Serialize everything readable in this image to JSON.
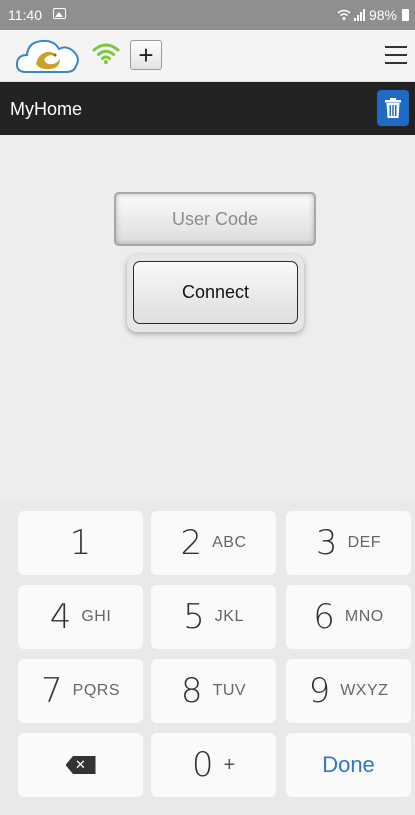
{
  "status_bar": {
    "time": "11:40",
    "battery": "98%",
    "icons": [
      "gallery-icon",
      "wifi-signal-icon",
      "cell-signal-icon",
      "battery-icon"
    ]
  },
  "toolbar": {
    "icons": [
      "cloud-logo-icon",
      "wifi-icon",
      "plus-icon",
      "hamburger-menu-icon"
    ],
    "add_label": "+",
    "wifi_color": "#7ec63b"
  },
  "title_bar": {
    "title": "MyHome",
    "trash_icon": "trash-icon",
    "trash_color": "#1f6ac4"
  },
  "main": {
    "user_code_placeholder": "User Code",
    "connect_label": "Connect"
  },
  "keypad": {
    "keys": [
      {
        "digit": "1",
        "letters": ""
      },
      {
        "digit": "2",
        "letters": "ABC"
      },
      {
        "digit": "3",
        "letters": "DEF"
      },
      {
        "digit": "4",
        "letters": "GHI"
      },
      {
        "digit": "5",
        "letters": "JKL"
      },
      {
        "digit": "6",
        "letters": "MNO"
      },
      {
        "digit": "7",
        "letters": "PQRS"
      },
      {
        "digit": "8",
        "letters": "TUV"
      },
      {
        "digit": "9",
        "letters": "WXYZ"
      },
      {
        "digit": "0",
        "letters": "+"
      }
    ],
    "backspace_icon": "backspace-icon",
    "done_label": "Done",
    "done_color": "#2f78c8"
  }
}
